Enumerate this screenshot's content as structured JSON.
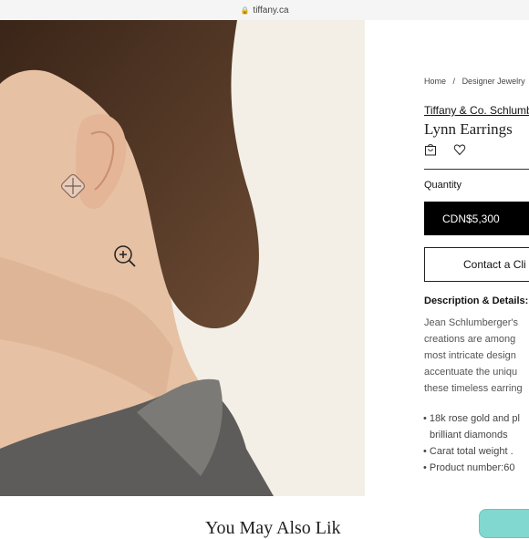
{
  "browser": {
    "url": "tiffany.ca"
  },
  "breadcrumb": [
    "Home",
    "/",
    "Designer Jewelry",
    "/"
  ],
  "product": {
    "brand": "Tiffany & Co. Schlumb",
    "name": "Lynn Earrings",
    "quantity_label": "Quantity",
    "price": "CDN$5,300",
    "contact_label": "Contact a Cli"
  },
  "description": {
    "title": "Description & Details:",
    "lines": [
      "Jean Schlumberger's",
      "creations are among",
      "most intricate design",
      "accentuate the uniqu",
      "these timeless earring"
    ]
  },
  "details": [
    "18k rose gold and pl",
    "brilliant diamonds",
    "Carat total weight .",
    "Product number:60"
  ],
  "related": {
    "title": "You May Also Lik"
  },
  "icons": {
    "bag": "shopping-bag-icon",
    "wishlist": "heart-icon",
    "zoom": "zoom-in-icon",
    "lock": "lock-icon"
  },
  "colors": {
    "accent": "#81d8d0",
    "price_bg": "#000000"
  }
}
